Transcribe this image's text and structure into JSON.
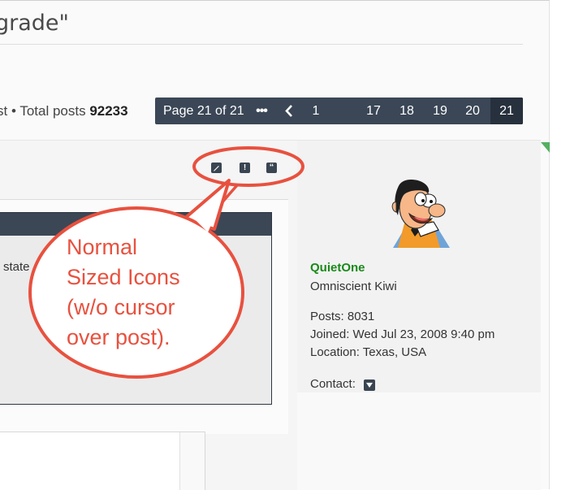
{
  "topic": {
    "title": "grade\""
  },
  "stats": {
    "prefix": "st • Total posts ",
    "total_posts": "92233"
  },
  "pagination": {
    "label": "Page 21 of 21",
    "pages": [
      "1",
      "17",
      "18",
      "19",
      "20",
      "21"
    ],
    "current": "21"
  },
  "post": {
    "inner_text": "state"
  },
  "profile": {
    "username": "QuietOne",
    "rank": "Omniscient Kiwi",
    "posts": "Posts: 8031",
    "joined": "Joined: Wed Jul 23, 2008 9:40 pm",
    "location": "Location: Texas, USA",
    "contact_label": "Contact:"
  },
  "annotation": {
    "line1": "Normal",
    "line2": "Sized Icons",
    "line3": "(w/o cursor",
    "line4": "over post)."
  },
  "colors": {
    "accent": "#3b4756",
    "callout": "#e8513f",
    "username": "#1a8a1a"
  }
}
